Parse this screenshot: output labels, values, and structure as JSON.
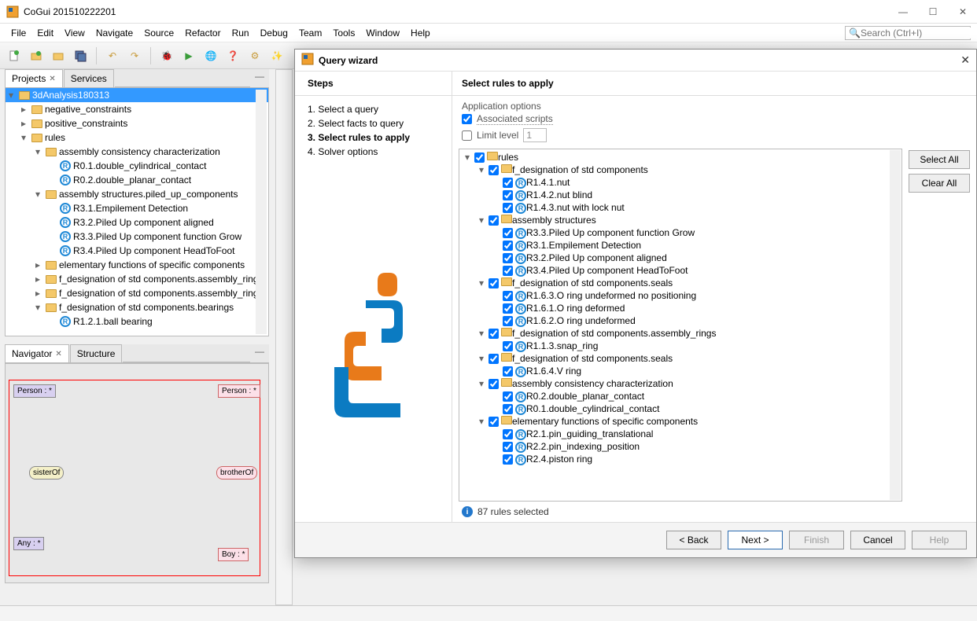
{
  "app": {
    "title": "CoGui 201510222201"
  },
  "menubar": [
    "File",
    "Edit",
    "View",
    "Navigate",
    "Source",
    "Refactor",
    "Run",
    "Debug",
    "Team",
    "Tools",
    "Window",
    "Help"
  ],
  "search_placeholder": "Search (Ctrl+I)",
  "tabs": {
    "left_top": [
      {
        "label": "Projects",
        "active": true,
        "closable": true
      },
      {
        "label": "Services",
        "active": false,
        "closable": false
      }
    ],
    "left_bottom": [
      {
        "label": "Navigator",
        "active": true,
        "closable": true
      },
      {
        "label": "Structure",
        "active": false,
        "closable": false
      }
    ]
  },
  "project_tree": [
    {
      "lvl": 0,
      "icon": "folder",
      "tw": "▾",
      "label": "3dAnalysis180313",
      "sel": true
    },
    {
      "lvl": 1,
      "icon": "folder",
      "tw": "▸",
      "label": "negative_constraints"
    },
    {
      "lvl": 1,
      "icon": "folder",
      "tw": "▸",
      "label": "positive_constraints"
    },
    {
      "lvl": 1,
      "icon": "folder",
      "tw": "▾",
      "label": "rules"
    },
    {
      "lvl": 2,
      "icon": "folder",
      "tw": "▾",
      "label": "assembly consistency characterization"
    },
    {
      "lvl": 3,
      "icon": "r",
      "tw": "",
      "label": "R0.1.double_cylindrical_contact"
    },
    {
      "lvl": 3,
      "icon": "r",
      "tw": "",
      "label": "R0.2.double_planar_contact"
    },
    {
      "lvl": 2,
      "icon": "folder",
      "tw": "▾",
      "label": "assembly structures.piled_up_components"
    },
    {
      "lvl": 3,
      "icon": "r",
      "tw": "",
      "label": "R3.1.Empilement Detection"
    },
    {
      "lvl": 3,
      "icon": "r",
      "tw": "",
      "label": "R3.2.Piled Up component aligned"
    },
    {
      "lvl": 3,
      "icon": "r",
      "tw": "",
      "label": "R3.3.Piled Up component function Grow"
    },
    {
      "lvl": 3,
      "icon": "r",
      "tw": "",
      "label": "R3.4.Piled Up component HeadToFoot"
    },
    {
      "lvl": 2,
      "icon": "folder",
      "tw": "▸",
      "label": "elementary functions of specific components"
    },
    {
      "lvl": 2,
      "icon": "folder",
      "tw": "▸",
      "label": "f_designation of std components.assembly_rings."
    },
    {
      "lvl": 2,
      "icon": "folder",
      "tw": "▸",
      "label": "f_designation of std components.assembly_rings."
    },
    {
      "lvl": 2,
      "icon": "folder",
      "tw": "▾",
      "label": "f_designation of std components.bearings"
    },
    {
      "lvl": 3,
      "icon": "r",
      "tw": "",
      "label": "R1.2.1.ball bearing"
    }
  ],
  "navigator_nodes": {
    "person1": "Person : *",
    "person2": "Person : *",
    "sisterof": "sisterOf",
    "brotherof": "brotherOf",
    "any": "Any : *",
    "boy": "Boy : *"
  },
  "dialog": {
    "title": "Query wizard",
    "steps_header": "Steps",
    "steps": [
      {
        "n": "1.",
        "label": "Select a query",
        "active": false
      },
      {
        "n": "2.",
        "label": "Select facts to query",
        "active": false
      },
      {
        "n": "3.",
        "label": "Select rules to apply",
        "active": true
      },
      {
        "n": "4.",
        "label": "Solver options",
        "active": false
      }
    ],
    "right_header": "Select rules to apply",
    "app_options_header": "Application options",
    "assoc_scripts": "Associated scripts",
    "limit_level": "Limit level",
    "limit_level_value": "1",
    "select_all": "Select All",
    "clear_all": "Clear All",
    "status": "87 rules selected",
    "buttons": {
      "back": "< Back",
      "next": "Next >",
      "finish": "Finish",
      "cancel": "Cancel",
      "help": "Help"
    },
    "rules": [
      {
        "lvl": 0,
        "tw": "▾",
        "icon": "folder",
        "label": "rules"
      },
      {
        "lvl": 1,
        "tw": "▾",
        "icon": "folder",
        "label": "f_designation of std components"
      },
      {
        "lvl": 2,
        "tw": "",
        "icon": "r",
        "label": "R1.4.1.nut"
      },
      {
        "lvl": 2,
        "tw": "",
        "icon": "r",
        "label": "R1.4.2.nut blind"
      },
      {
        "lvl": 2,
        "tw": "",
        "icon": "r",
        "label": "R1.4.3.nut with lock nut"
      },
      {
        "lvl": 1,
        "tw": "▾",
        "icon": "folder",
        "label": "assembly structures"
      },
      {
        "lvl": 2,
        "tw": "",
        "icon": "r",
        "label": "R3.3.Piled Up component function Grow"
      },
      {
        "lvl": 2,
        "tw": "",
        "icon": "r",
        "label": "R3.1.Empilement Detection"
      },
      {
        "lvl": 2,
        "tw": "",
        "icon": "r",
        "label": "R3.2.Piled Up component aligned"
      },
      {
        "lvl": 2,
        "tw": "",
        "icon": "r",
        "label": "R3.4.Piled Up component HeadToFoot"
      },
      {
        "lvl": 1,
        "tw": "▾",
        "icon": "folder",
        "label": "f_designation of std components.seals"
      },
      {
        "lvl": 2,
        "tw": "",
        "icon": "r",
        "label": "R1.6.3.O ring undeformed no positioning"
      },
      {
        "lvl": 2,
        "tw": "",
        "icon": "r",
        "label": "R1.6.1.O ring deformed"
      },
      {
        "lvl": 2,
        "tw": "",
        "icon": "r",
        "label": "R1.6.2.O ring undeformed"
      },
      {
        "lvl": 1,
        "tw": "▾",
        "icon": "folder",
        "label": "f_designation of std components.assembly_rings"
      },
      {
        "lvl": 2,
        "tw": "",
        "icon": "r",
        "label": "R1.1.3.snap_ring"
      },
      {
        "lvl": 1,
        "tw": "▾",
        "icon": "folder",
        "label": "f_designation of std components.seals"
      },
      {
        "lvl": 2,
        "tw": "",
        "icon": "r",
        "label": "R1.6.4.V ring"
      },
      {
        "lvl": 1,
        "tw": "▾",
        "icon": "folder",
        "label": "assembly consistency characterization"
      },
      {
        "lvl": 2,
        "tw": "",
        "icon": "r",
        "label": "R0.2.double_planar_contact"
      },
      {
        "lvl": 2,
        "tw": "",
        "icon": "r",
        "label": "R0.1.double_cylindrical_contact"
      },
      {
        "lvl": 1,
        "tw": "▾",
        "icon": "folder",
        "label": "elementary functions of specific components"
      },
      {
        "lvl": 2,
        "tw": "",
        "icon": "r",
        "label": "R2.1.pin_guiding_translational"
      },
      {
        "lvl": 2,
        "tw": "",
        "icon": "r",
        "label": "R2.2.pin_indexing_position"
      },
      {
        "lvl": 2,
        "tw": "",
        "icon": "r",
        "label": "R2.4.piston ring"
      }
    ]
  }
}
